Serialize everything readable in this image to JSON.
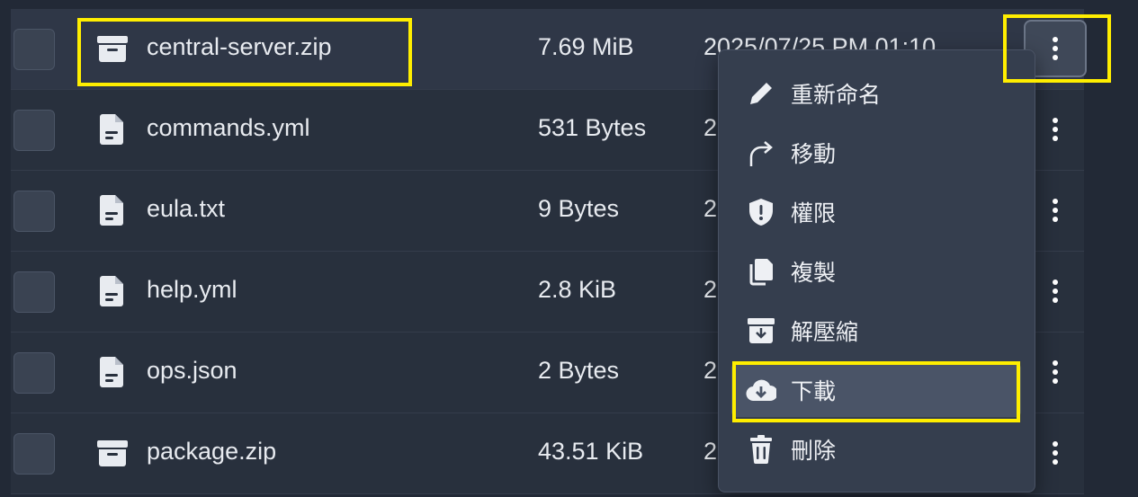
{
  "files": [
    {
      "name": "central-server.zip",
      "size": "7.69 MiB",
      "date": "2025/07/25 PM 01:10",
      "icon": "archive-icon"
    },
    {
      "name": "commands.yml",
      "size": "531 Bytes",
      "date": "2",
      "icon": "file-text-icon"
    },
    {
      "name": "eula.txt",
      "size": "9 Bytes",
      "date": "2",
      "icon": "file-text-icon"
    },
    {
      "name": "help.yml",
      "size": "2.8 KiB",
      "date": "2",
      "icon": "file-text-icon"
    },
    {
      "name": "ops.json",
      "size": "2 Bytes",
      "date": "2",
      "icon": "file-text-icon"
    },
    {
      "name": "package.zip",
      "size": "43.51 KiB",
      "date": "2",
      "icon": "archive-icon"
    }
  ],
  "context_menu": {
    "items": [
      {
        "label": "重新命名",
        "icon": "pencil-icon"
      },
      {
        "label": "移動",
        "icon": "move-arrow-icon"
      },
      {
        "label": "權限",
        "icon": "shield-icon"
      },
      {
        "label": "複製",
        "icon": "copy-icon"
      },
      {
        "label": "解壓縮",
        "icon": "unarchive-icon"
      },
      {
        "label": "下載",
        "icon": "cloud-download-icon"
      },
      {
        "label": "刪除",
        "icon": "trash-icon"
      }
    ],
    "selected": "下載"
  },
  "colors": {
    "background": "#222936",
    "highlight": "#ffee00"
  }
}
